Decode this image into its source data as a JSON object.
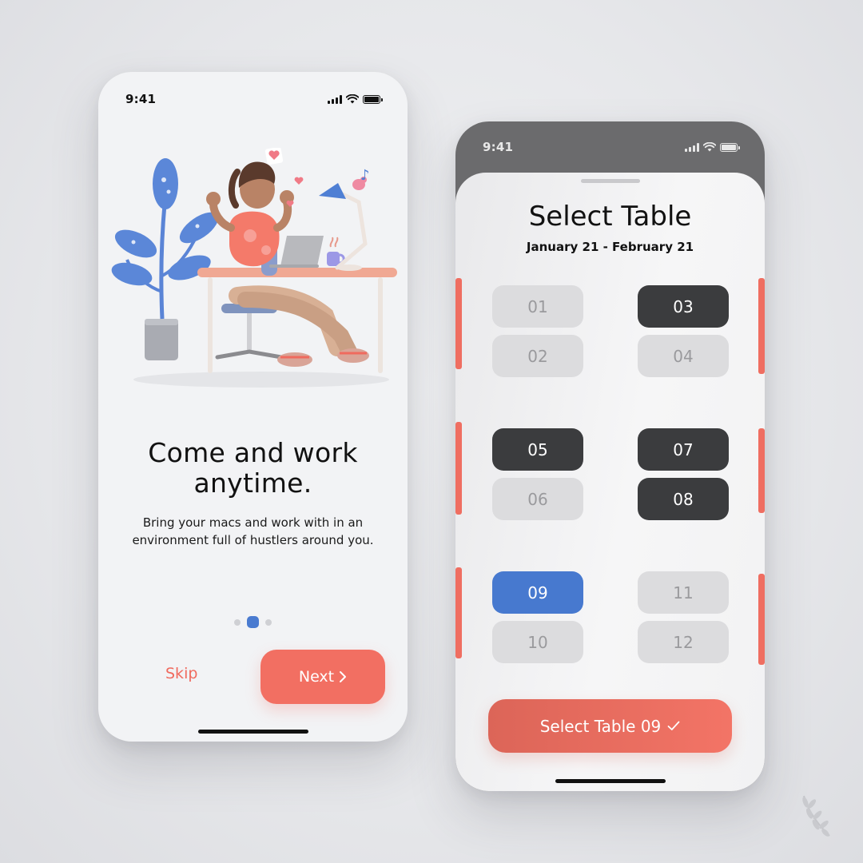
{
  "phone1": {
    "status_time": "9:41",
    "headline_line1": "Come and work",
    "headline_line2": "anytime.",
    "subtitle_line1": "Bring your macs and work with in an",
    "subtitle_line2": "environment full of hustlers around you.",
    "pager": {
      "pages": 3,
      "active_index": 1
    },
    "skip_label": "Skip",
    "next_label": "Next",
    "next_icon": "chevron-right-icon"
  },
  "phone2": {
    "status_time": "9:41",
    "title": "Select Table",
    "date_range": "January 21 - February 21",
    "tables": {
      "t01": {
        "label": "01",
        "state": "available"
      },
      "t02": {
        "label": "02",
        "state": "available"
      },
      "t03": {
        "label": "03",
        "state": "booked"
      },
      "t04": {
        "label": "04",
        "state": "available"
      },
      "t05": {
        "label": "05",
        "state": "booked"
      },
      "t06": {
        "label": "06",
        "state": "available"
      },
      "t07": {
        "label": "07",
        "state": "booked"
      },
      "t08": {
        "label": "08",
        "state": "booked"
      },
      "t09": {
        "label": "09",
        "state": "selected"
      },
      "t10": {
        "label": "10",
        "state": "available"
      },
      "t11": {
        "label": "11",
        "state": "available"
      },
      "t12": {
        "label": "12",
        "state": "available"
      }
    },
    "cta_label": "Select Table 09",
    "cta_icon": "checkmark-icon"
  },
  "colors": {
    "accent_coral": "#f26f62",
    "selected_blue": "#4779cf",
    "booked_dark": "#3b3c3e",
    "available_gray": "#dcdcde"
  }
}
